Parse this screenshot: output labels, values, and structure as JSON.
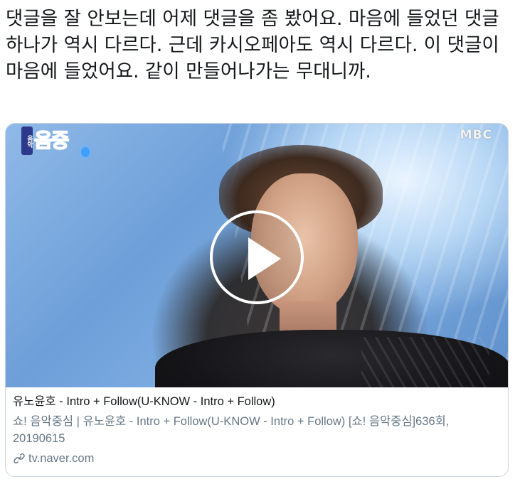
{
  "tweet": {
    "text": "댓글을 잘 안보는데 어제 댓글을 좀 봤어요. 마음에 들었던 댓글 하나가 역시 다르다. 근데 카시오페아도 역시 다르다. 이 댓글이 마음에 들었어요. 같이 만들어나가는 무대니까."
  },
  "card": {
    "media": {
      "show_logo_side": "음악",
      "show_logo_main": "음중",
      "broadcaster_logo": "MBC",
      "play_icon": "play-icon"
    },
    "title": "유노윤호 - Intro + Follow(U-KNOW - Intro + Follow)",
    "description": "쇼! 음악중심 | 유노윤호 - Intro + Follow(U-KNOW - Intro + Follow) [쇼! 음악중심]636회, 20190615",
    "domain": "tv.naver.com",
    "link_icon": "link-icon"
  },
  "colors": {
    "text": "#14171a",
    "secondary_text": "#657786",
    "card_border": "#ccd6dd"
  }
}
